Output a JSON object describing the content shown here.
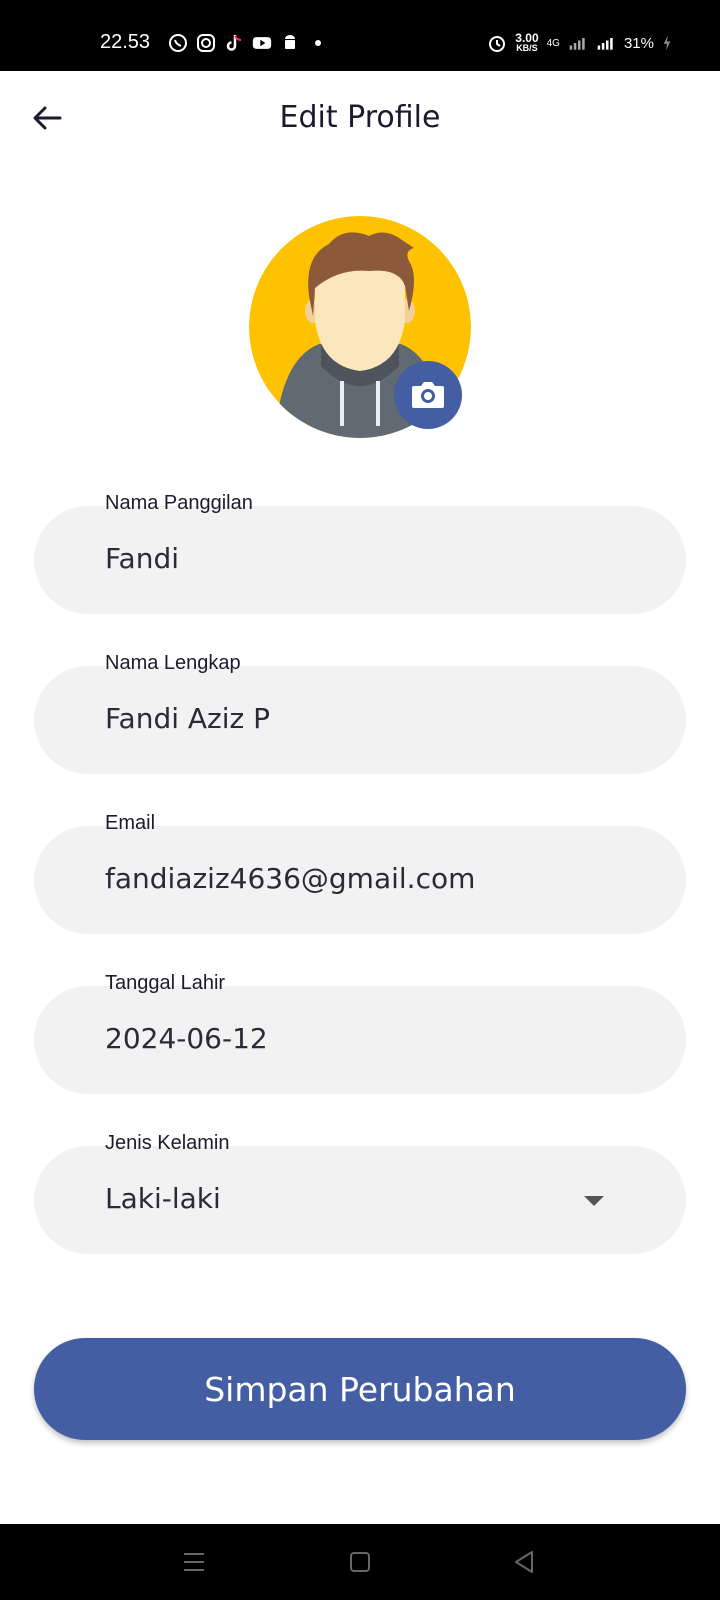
{
  "status_bar": {
    "time": "22.53",
    "speed_value": "3.00",
    "speed_unit": "KB/S",
    "network": "4G",
    "battery": "31%"
  },
  "app_bar": {
    "title": "Edit Profile",
    "back_icon": "arrow-left-icon"
  },
  "avatar": {
    "image": "cartoon-man-avatar",
    "camera_icon": "camera-icon"
  },
  "form": {
    "nickname": {
      "label": "Nama Panggilan",
      "value": "Fandi"
    },
    "full_name": {
      "label": "Nama Lengkap",
      "value": "Fandi Aziz P"
    },
    "email": {
      "label": "Email",
      "value": "fandiaziz4636@gmail.com"
    },
    "birth_date": {
      "label": "Tanggal Lahir",
      "value": "2024-06-12"
    },
    "gender": {
      "label": "Jenis Kelamin",
      "value": "Laki-laki"
    }
  },
  "save_button": {
    "label": "Simpan Perubahan"
  },
  "colors": {
    "primary": "#445ea4",
    "field_bg": "#f2f2f2",
    "avatar_bg": "#ffc200"
  }
}
